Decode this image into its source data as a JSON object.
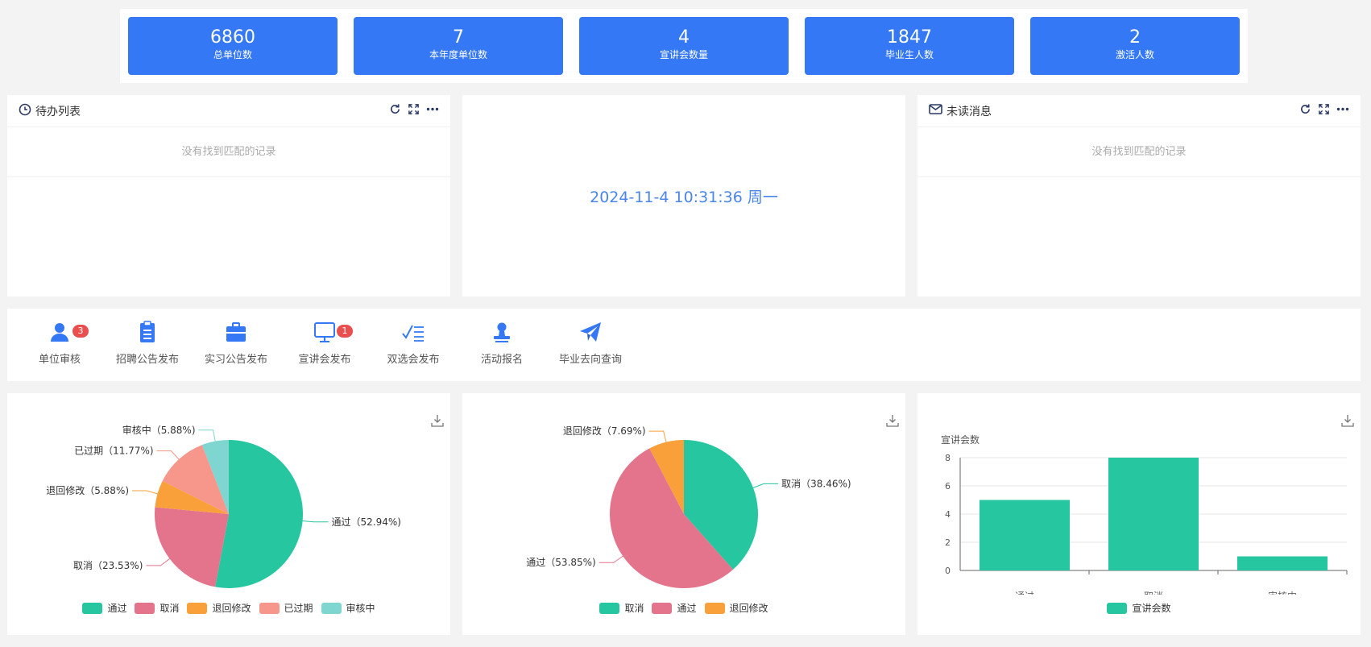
{
  "stats": [
    {
      "value": "6860",
      "label": "总单位数"
    },
    {
      "value": "7",
      "label": "本年度单位数"
    },
    {
      "value": "4",
      "label": "宣讲会数量"
    },
    {
      "value": "1847",
      "label": "毕业生人数"
    },
    {
      "value": "2",
      "label": "激活人数"
    }
  ],
  "todo": {
    "title": "待办列表",
    "empty": "没有找到匹配的记录",
    "icon": "clock-icon"
  },
  "clock": {
    "datetime": "2024-11-4 10:31:36 周一"
  },
  "messages": {
    "title": "未读消息",
    "empty": "没有找到匹配的记录",
    "icon": "mail-icon"
  },
  "shortcuts": [
    {
      "label": "单位审核",
      "badge": "3",
      "icon": "user-icon"
    },
    {
      "label": "招聘公告发布",
      "badge": "",
      "icon": "clipboard-icon"
    },
    {
      "label": "实习公告发布",
      "badge": "",
      "icon": "briefcase-icon"
    },
    {
      "label": "宣讲会发布",
      "badge": "1",
      "icon": "monitor-icon"
    },
    {
      "label": "双选会发布",
      "badge": "",
      "icon": "checklist-icon"
    },
    {
      "label": "活动报名",
      "badge": "",
      "icon": "stamp-icon"
    },
    {
      "label": "毕业去向查询",
      "badge": "",
      "icon": "paper-plane-icon"
    }
  ],
  "colors": {
    "accent": "#3478f6",
    "teal": "#26c6a0",
    "pink": "#e3748b",
    "orange": "#f9a03a",
    "salmon": "#f7968a",
    "aqua": "#7fd5cf"
  },
  "chart_data": [
    {
      "type": "pie",
      "slices": [
        {
          "name": "通过",
          "value": 52.94,
          "label": "通过（52.94%)",
          "color": "#26c6a0"
        },
        {
          "name": "取消",
          "value": 23.53,
          "label": "取消（23.53%)",
          "color": "#e3748b"
        },
        {
          "name": "退回修改",
          "value": 5.88,
          "label": "退回修改（5.88%)",
          "color": "#f9a03a"
        },
        {
          "name": "已过期",
          "value": 11.77,
          "label": "已过期（11.77%)",
          "color": "#f7968a"
        },
        {
          "name": "审核中",
          "value": 5.88,
          "label": "审核中（5.88%)",
          "color": "#7fd5cf"
        }
      ],
      "legend": [
        "通过",
        "取消",
        "退回修改",
        "已过期",
        "审核中"
      ],
      "legend_position": "bottom"
    },
    {
      "type": "pie",
      "slices": [
        {
          "name": "取消",
          "value": 38.46,
          "label": "取消（38.46%)",
          "color": "#26c6a0"
        },
        {
          "name": "通过",
          "value": 53.85,
          "label": "通过（53.85%)",
          "color": "#e3748b"
        },
        {
          "name": "退回修改",
          "value": 7.69,
          "label": "退回修改（7.69%)",
          "color": "#f9a03a"
        }
      ],
      "legend": [
        "取消",
        "通过",
        "退回修改"
      ],
      "legend_position": "bottom"
    },
    {
      "type": "bar",
      "ylabel": "宣讲会数",
      "categories": [
        "通过",
        "取消",
        "审核中"
      ],
      "series": [
        {
          "name": "宣讲会数",
          "values": [
            5,
            8,
            1
          ],
          "color": "#26c6a0"
        }
      ],
      "ylim": [
        0,
        8
      ],
      "yticks": [
        0,
        2,
        4,
        6,
        8
      ],
      "grid": true,
      "legend_position": "bottom"
    }
  ]
}
